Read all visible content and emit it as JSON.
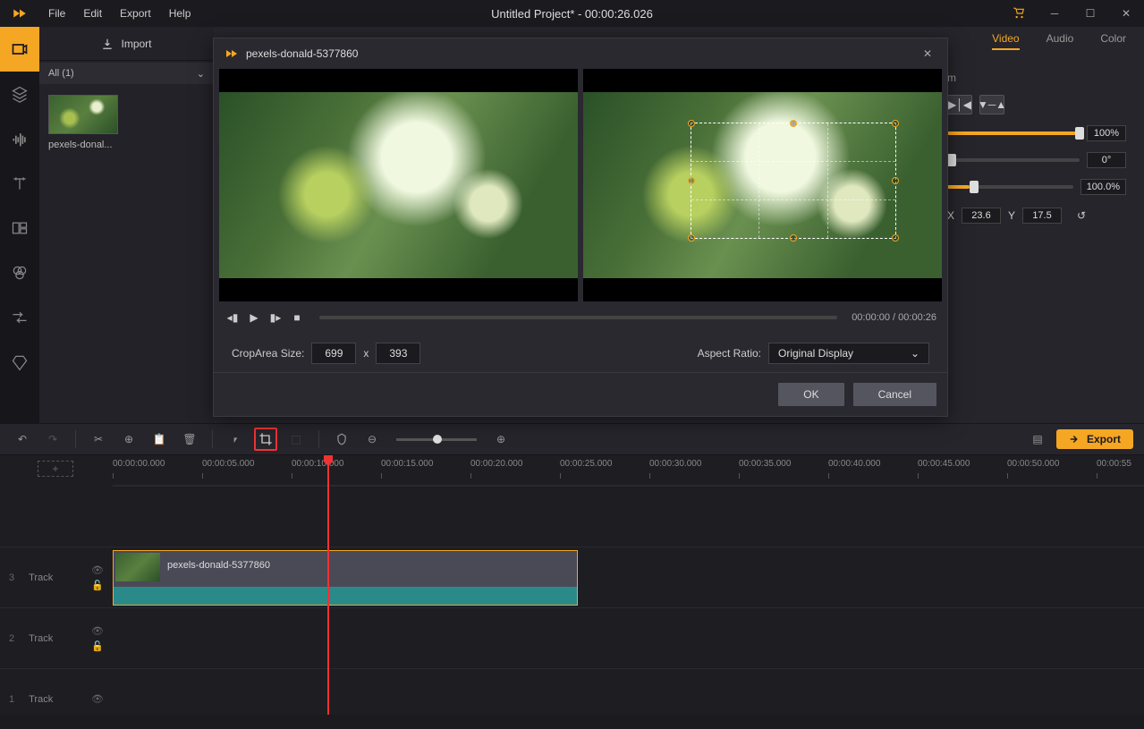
{
  "title": "Untitled Project* - 00:00:26.026",
  "menu": {
    "file": "File",
    "edit": "Edit",
    "export": "Export",
    "help": "Help"
  },
  "import_label": "Import",
  "media_filter": "All (1)",
  "thumb_name": "pexels-donal...",
  "tabs": {
    "video": "Video",
    "audio": "Audio",
    "color": "Color"
  },
  "props": {
    "label_m": "m",
    "speed_val": "100%",
    "rotate_val": "0°",
    "opacity_val": "100.0%",
    "x_label": "X",
    "x_val": "23.6",
    "y_label": "Y",
    "y_val": "17.5"
  },
  "toolbar": {
    "export": "Export"
  },
  "track_label": "Track",
  "tracks": {
    "t1": "3",
    "t2": "2",
    "t3": "1"
  },
  "clip_label": "pexels-donald-5377860",
  "ruler": [
    "00:00:00.000",
    "00:00:05.000",
    "00:00:10.000",
    "00:00:15.000",
    "00:00:20.000",
    "00:00:25.000",
    "00:00:30.000",
    "00:00:35.000",
    "00:00:40.000",
    "00:00:45.000",
    "00:00:50.000",
    "00:00:55"
  ],
  "modal": {
    "title": "pexels-donald-5377860",
    "time": "00:00:00 / 00:00:26",
    "crop_label": "CropArea Size:",
    "crop_w": "699",
    "crop_x": "x",
    "crop_h": "393",
    "aspect_label": "Aspect Ratio:",
    "aspect_val": "Original Display",
    "ok": "OK",
    "cancel": "Cancel"
  }
}
